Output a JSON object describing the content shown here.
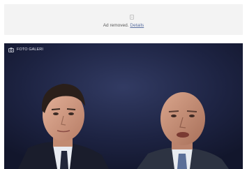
{
  "ad": {
    "icon": "ad-placeholder-icon",
    "removed_text": "Ad removed.",
    "details_link": "Details"
  },
  "gallery": {
    "label": "FOTO GALERI",
    "icon": "camera-icon",
    "photo": "two-men-portrait-photo"
  },
  "colors": {
    "ad_background": "#f3f3f3",
    "gallery_background": "#1c2240",
    "link": "#5a6fa0"
  }
}
